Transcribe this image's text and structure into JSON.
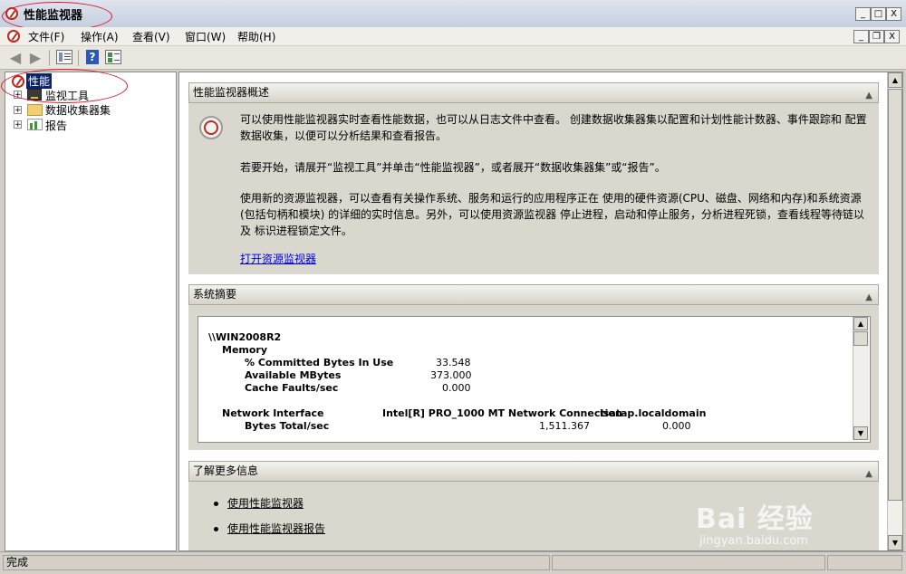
{
  "window": {
    "title": "性能监视器",
    "controls": {
      "minimize": "_",
      "maximize": "□",
      "close": "X"
    },
    "inner_controls": {
      "minimize": "_",
      "restore": "❐",
      "close": "X"
    }
  },
  "menu": {
    "items": [
      "文件(F)",
      "操作(A)",
      "查看(V)",
      "窗口(W)",
      "帮助(H)"
    ]
  },
  "toolbar": {
    "icons": [
      "back-arrow-icon",
      "forward-arrow-icon",
      "show-hide-tree-icon",
      "help-icon",
      "properties-icon"
    ]
  },
  "tree": {
    "root": "性能",
    "children": [
      "监视工具",
      "数据收集器集",
      "报告"
    ]
  },
  "overview": {
    "header": "性能监视器概述",
    "para1": "可以使用性能监视器实时查看性能数据，也可以从日志文件中查看。 创建数据收集器集以配置和计划性能计数器、事件跟踪和 配置数据收集，以便可以分析结果和查看报告。",
    "para2": "若要开始，请展开“监视工具”并单击“性能监视器”，或者展开“数据收集器集”或“报告”。",
    "para3": "使用新的资源监视器，可以查看有关操作系统、服务和运行的应用程序正在 使用的硬件资源(CPU、磁盘、网络和内存)和系统资源(包括句柄和模块) 的详细的实时信息。另外，可以使用资源监视器 停止进程，启动和停止服务，分析进程死锁，查看线程等待链以及 标识进程锁定文件。",
    "link": "打开资源监视器"
  },
  "summary": {
    "header": "系统摘要",
    "host": "\\\\WIN2008R2",
    "memory_label": "Memory",
    "memory_rows": [
      {
        "name": "% Committed Bytes In Use",
        "value": "33.548"
      },
      {
        "name": "Available MBytes",
        "value": "373.000"
      },
      {
        "name": "Cache Faults/sec",
        "value": "0.000"
      }
    ],
    "net_label": "Network Interface",
    "net_col1": "Intel[R] PRO_1000 MT Network Connection",
    "net_col2": "isatap.localdomain",
    "net_rows": [
      {
        "name": "Bytes Total/sec",
        "value1": "1,511.367",
        "value2": "0.000"
      }
    ]
  },
  "learn_more": {
    "header": "了解更多信息",
    "links": [
      "使用性能监视器",
      "使用性能监视器报告"
    ]
  },
  "status": {
    "text": "完成"
  },
  "watermark": {
    "text": "Bai 经验",
    "url": "jingyan.baidu.com"
  },
  "colors": {
    "highlight_ellipse": "#e0142a",
    "link": "#0000ee",
    "selected_bg": "#0a246a"
  }
}
